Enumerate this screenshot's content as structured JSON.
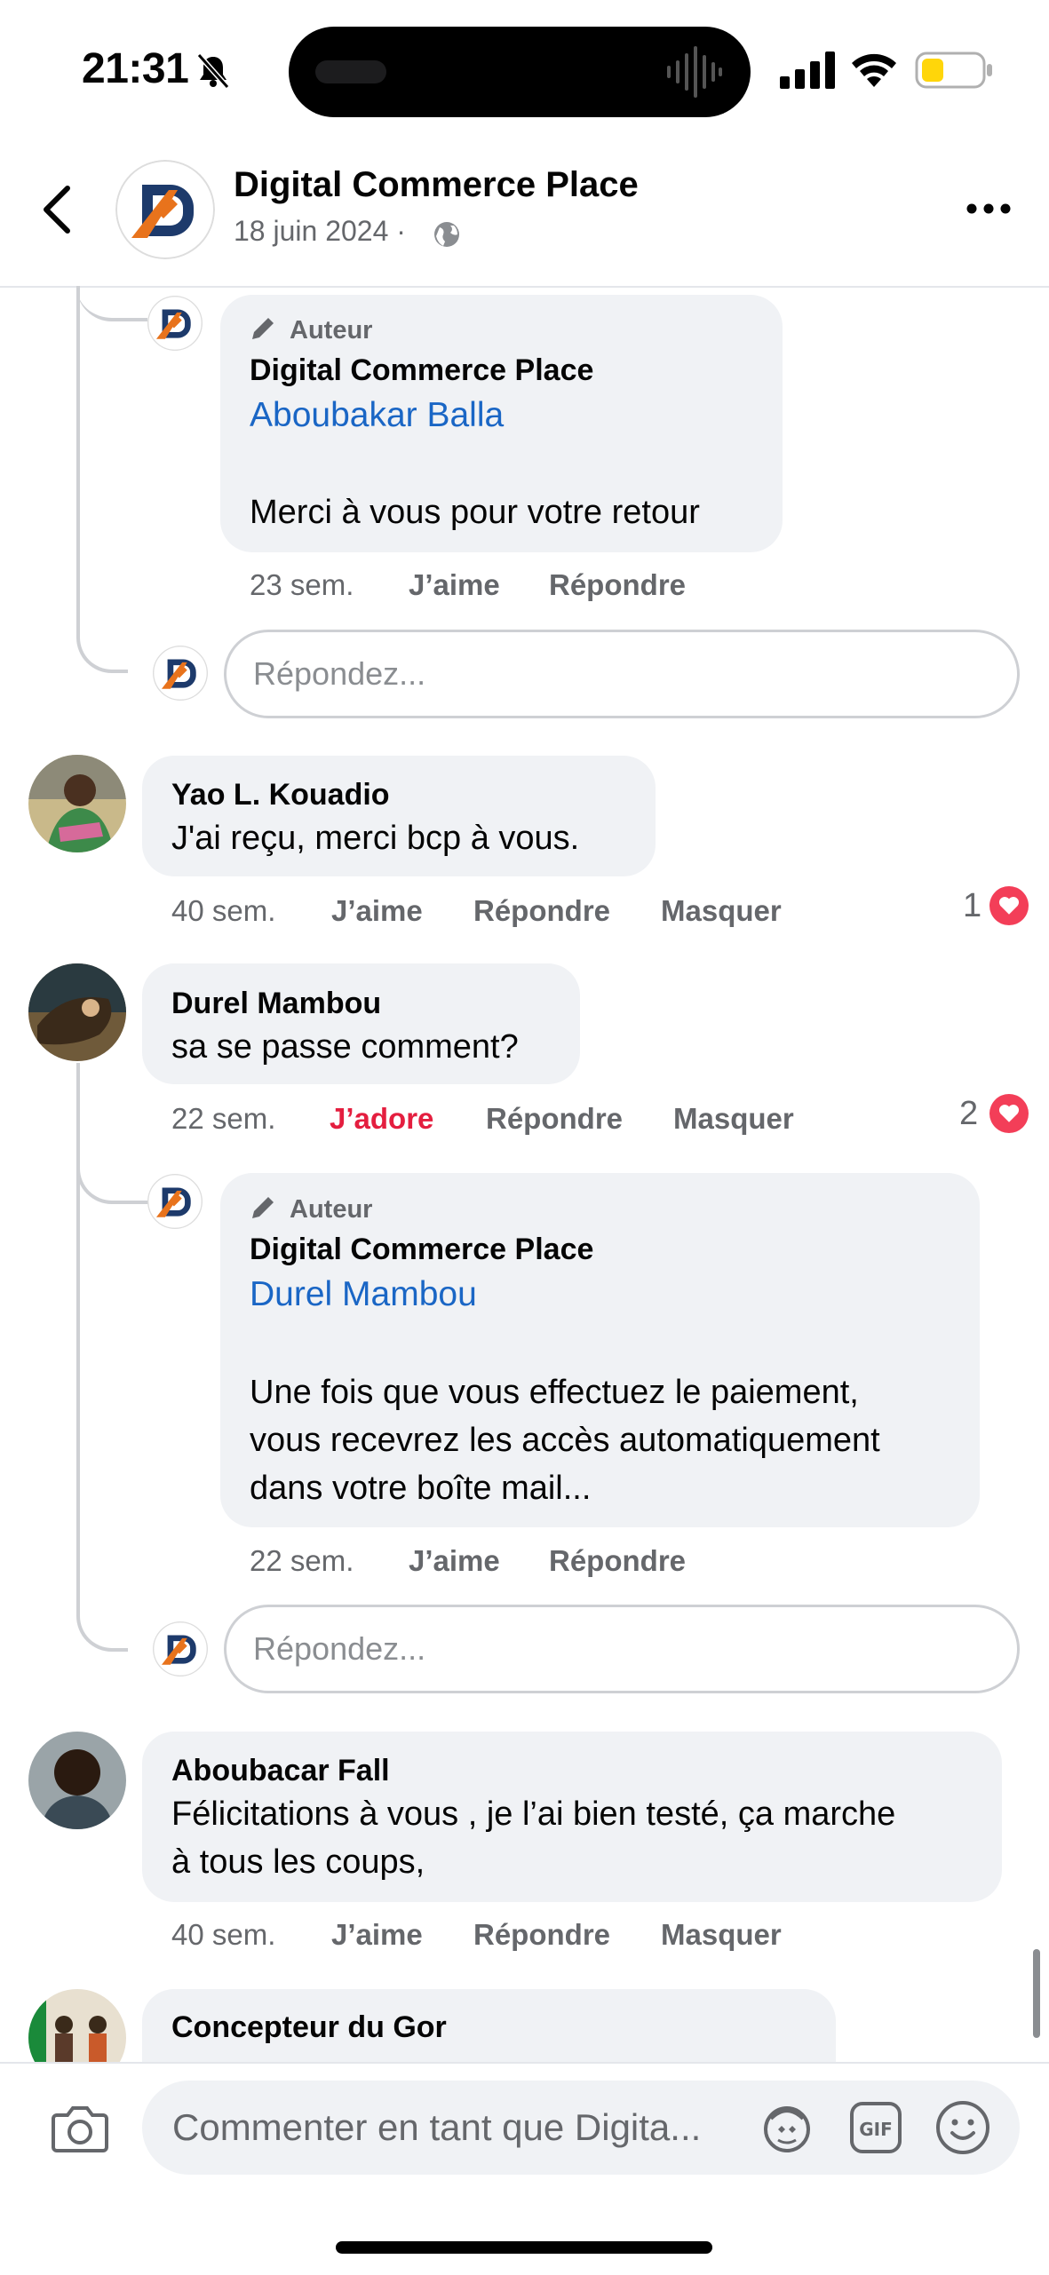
{
  "status_bar": {
    "time": "21:31"
  },
  "header": {
    "page_name": "Digital Commerce Place",
    "date": "18 juin 2024 ·"
  },
  "comments": [
    {
      "author_tag": "Auteur",
      "name": "Digital Commerce Place",
      "mention": "Aboubakar Balla",
      "text": "Merci à vous pour votre retour",
      "time": "23 sem.",
      "like": "J’aime",
      "reply": "Répondre"
    },
    {
      "reply_placeholder": "Répondez..."
    },
    {
      "name": "Yao L. Kouadio",
      "text": "J'ai reçu, merci bcp à vous.",
      "time": "40 sem.",
      "like": "J’aime",
      "reply": "Répondre",
      "hide": "Masquer",
      "reactions": "1"
    },
    {
      "name": "Durel Mambou",
      "text": "sa se passe comment?",
      "time": "22 sem.",
      "like": "J’adore",
      "reply": "Répondre",
      "hide": "Masquer",
      "reactions": "2"
    },
    {
      "author_tag": "Auteur",
      "name": "Digital Commerce Place",
      "mention": "Durel Mambou",
      "text_lines": [
        "Une fois que vous effectuez le paiement,",
        "vous recevrez les accès automatiquement",
        "dans votre boîte mail..."
      ],
      "time": "22 sem.",
      "like": "J’aime",
      "reply": "Répondre"
    },
    {
      "reply_placeholder": "Répondez..."
    },
    {
      "name": "Aboubacar Fall",
      "text_lines": [
        "Félicitations à vous , je l’ai bien testé, ça marche",
        "à tous les coups,"
      ],
      "time": "40 sem.",
      "like": "J’aime",
      "reply": "Répondre",
      "hide": "Masquer"
    },
    {
      "name": "Concepteur du Gor"
    }
  ],
  "composer": {
    "placeholder": "Commenter en tant que Digita..."
  },
  "colors": {
    "link": "#1a66c5",
    "love": "#e41e3f",
    "heart_badge": "#f33e58",
    "bubble": "#f0f2f5",
    "brand_orange": "#e8731c",
    "brand_navy": "#1d3a6b"
  }
}
